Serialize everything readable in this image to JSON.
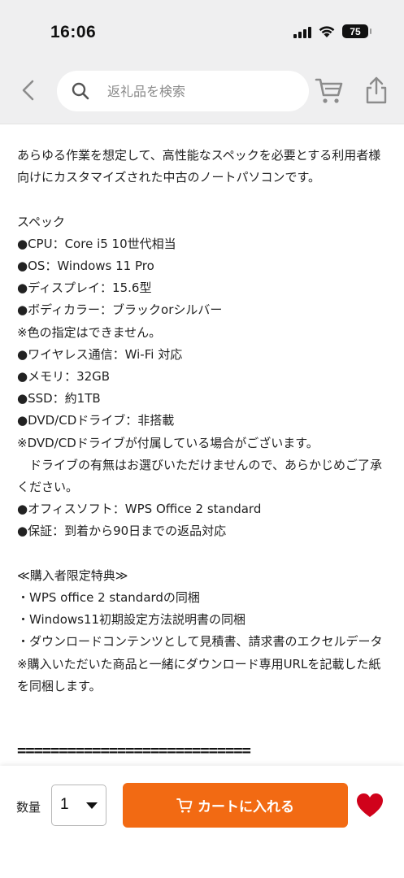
{
  "status_bar": {
    "time": "16:06",
    "battery": "75"
  },
  "header": {
    "back_icon": "chevron-left-icon",
    "search": {
      "placeholder": "返礼品を検索",
      "value": ""
    },
    "cart_icon": "cart-icon",
    "share_icon": "share-icon"
  },
  "description": {
    "intro": "あらゆる作業を想定して、高性能なスペックを必要とする利用者様向けにカスタマイズされた中古のノートパソコンです。",
    "spec_lines": [
      "",
      "スペック",
      "●CPU：Core i5 10世代相当",
      "●OS：Windows 11 Pro",
      "●ディスプレイ：15.6型",
      "●ボディカラー：ブラックorシルバー",
      "※色の指定はできません。",
      "●ワイヤレス通信：Wi-Fi 対応",
      "●メモリ：32GB",
      "●SSD：約1TB",
      "●DVD/CDドライブ：非搭載",
      "※DVD/CDドライブが付属している場合がございます。"
    ],
    "drive_note": "　ドライブの有無はお選びいただけませんので、あらかじめご了承ください。",
    "tail_lines": [
      "●オフィスソフト：WPS Office 2 standard",
      "●保証：到着から90日までの返品対応",
      "",
      "≪購入者限定特典≫",
      "・WPS office 2 standardの同梱",
      "・Windows11初期設定方法説明書の同梱"
    ],
    "download_note": "・ダウンロードコンテンツとして見積書、請求書のエクセルデータ",
    "url_note": "※購入いただいた商品と一緒にダウンロード専用URLを記載した紙を同梱します。",
    "separator": "============================"
  },
  "bottom_bar": {
    "quantity_label": "数量",
    "quantity_value": "1",
    "add_to_cart_label": "カートに入れる",
    "favorite_icon": "heart-icon"
  },
  "colors": {
    "accent": "#f26a13",
    "favorite": "#d0021b",
    "header_bg": "#efeff0"
  }
}
